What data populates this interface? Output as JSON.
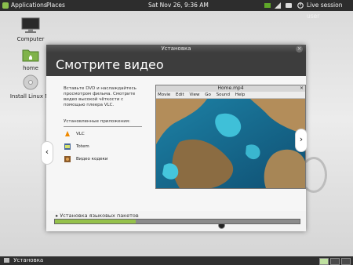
{
  "topbar": {
    "menus": [
      "Applications",
      "Places"
    ],
    "clock": "Sat Nov 26,  9:36 AM",
    "user": "Live session user",
    "icons": [
      "battery-icon",
      "network-icon",
      "volume-icon",
      "chat-icon",
      "power-icon"
    ]
  },
  "desktop": {
    "icons": [
      {
        "label": "Computer",
        "icon": "computer-icon"
      },
      {
        "label": "home",
        "icon": "folder-icon"
      },
      {
        "label": "Install Linux Mi",
        "icon": "disc-icon"
      }
    ]
  },
  "dialog": {
    "title": "Установка",
    "heading": "Смотрите видео",
    "description": "Вставьте DVD и наслаждайтесь просмотром фильма. Смотрите видео высокой чёткости с помощью плеера VLC.",
    "installed_heading": "Установленные приложения:",
    "apps": [
      {
        "label": "VLC",
        "icon": "vlc-icon"
      },
      {
        "label": "Totem",
        "icon": "totem-icon"
      },
      {
        "label": "Видео кодеки",
        "icon": "codec-icon"
      }
    ],
    "prev": "‹",
    "next": "›",
    "movie_window": {
      "title": "Home.mp4",
      "menu": [
        "Movie",
        "Edit",
        "View",
        "Go",
        "Sound",
        "Help"
      ]
    },
    "status": "▸ Установка языковых пакетов",
    "progress": 0.33
  },
  "taskbar": {
    "item": "Установка"
  },
  "colors": {
    "panel": "#2d2d2d",
    "accent_green": "#95c14b",
    "header": "#3d3d3d"
  }
}
